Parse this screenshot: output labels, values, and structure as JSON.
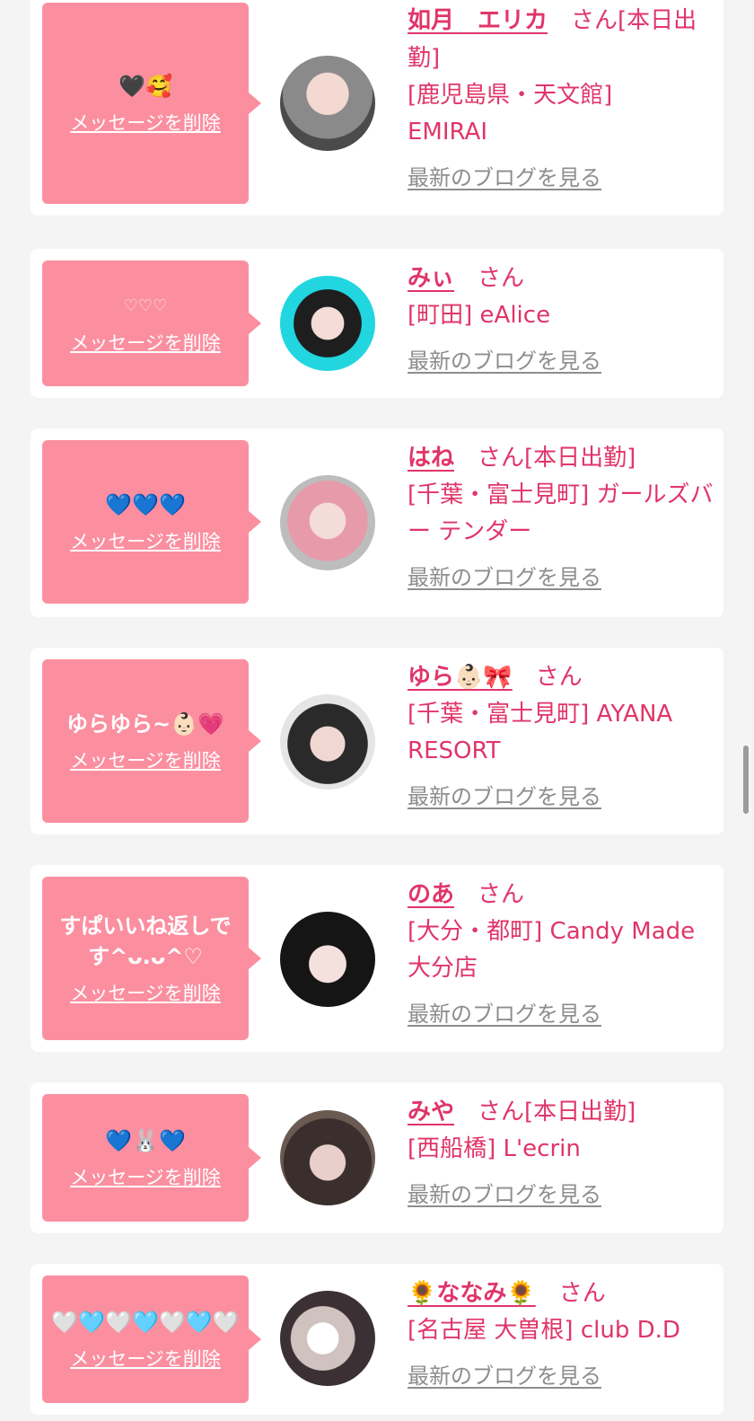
{
  "delete_label": "メッセージを削除",
  "blog_label": "最新のブログを見る",
  "san_label": "さん",
  "colors": {
    "accent": "#e0356a",
    "bubble": "#fb8fa0",
    "link": "#8d8d8d",
    "background": "#f4f4f4"
  },
  "cards": [
    {
      "message": "🖤🥰",
      "name": "如月　エリカ",
      "status": "[本日出勤]",
      "shop": "[鹿児島県・天文館] EMIRAI"
    },
    {
      "message": "♡♡♡",
      "name": "みぃ",
      "status": "",
      "shop": "[町田] eAlice"
    },
    {
      "message": "💙💙💙",
      "name": "はね",
      "status": "[本日出勤]",
      "shop": "[千葉・富士見町] ガールズバー テンダー"
    },
    {
      "message": "ゆらゆら~👶🏻💗",
      "name": "ゆら👶🏻🎀",
      "status": "",
      "shop": "[千葉・富士見町] AYANA RESORT"
    },
    {
      "message": "すぱいいね返しです^ᴗ.ᴗ^♡",
      "name": "のあ",
      "status": "",
      "shop": "[大分・都町] Candy Made 大分店"
    },
    {
      "message": "💙🐰💙",
      "name": "みや",
      "status": "[本日出勤]",
      "shop": "[西船橋] L'ecrin"
    },
    {
      "message": "🤍🩵🤍🩵🤍🩵🤍",
      "name": "🌻ななみ🌻",
      "status": "",
      "shop": "[名古屋 大曽根] club D.D"
    }
  ]
}
